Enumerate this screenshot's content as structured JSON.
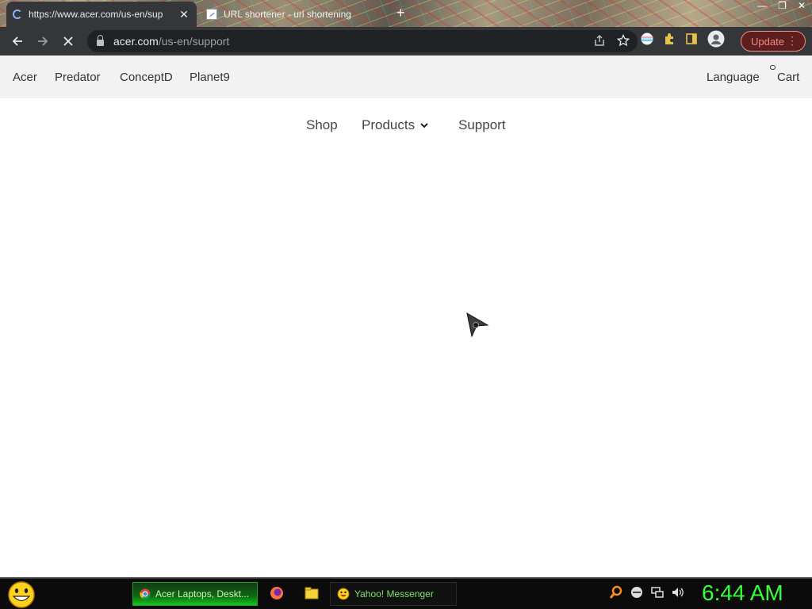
{
  "browser": {
    "tabs": [
      {
        "title": "https://www.acer.com/us-en/sup",
        "state": "loading",
        "active": true
      },
      {
        "title": "URL shortener - url shortening",
        "active": false
      }
    ],
    "address": {
      "domain": "acer.com",
      "path": "/us-en/support"
    },
    "update_label": "Update",
    "icons": [
      "back-icon",
      "forward-icon",
      "stop-icon",
      "share-icon",
      "bookmark-star-icon",
      "profile-flag-icon",
      "extensions-icon",
      "side-panel-icon",
      "account-icon",
      "menu-dots-icon"
    ]
  },
  "site": {
    "top_nav": {
      "items": [
        "Acer",
        "Predator",
        "ConceptD",
        "Planet9"
      ],
      "language": "Language",
      "cart": "Cart"
    },
    "main_nav": {
      "shop": "Shop",
      "products": "Products",
      "support": "Support"
    }
  },
  "taskbar": {
    "tasks": [
      {
        "label": "Acer Laptops, Deskt...",
        "icon": "chrome-icon",
        "active": true
      },
      {
        "label": "Yahoo! Messenger",
        "icon": "yahoo-messenger-icon",
        "active": false
      }
    ],
    "quick_launch": [
      "firefox-icon",
      "folder-icon"
    ],
    "tray_icons": [
      "search-icon",
      "network-icon",
      "display-icon",
      "volume-icon"
    ],
    "clock": "6:44 AM"
  },
  "colors": {
    "toolbar": "#35363a",
    "omnibox": "#202124",
    "update_accent": "#f28b82",
    "clock": "#35ff35",
    "top_nav_bg": "#f2f2f2"
  }
}
